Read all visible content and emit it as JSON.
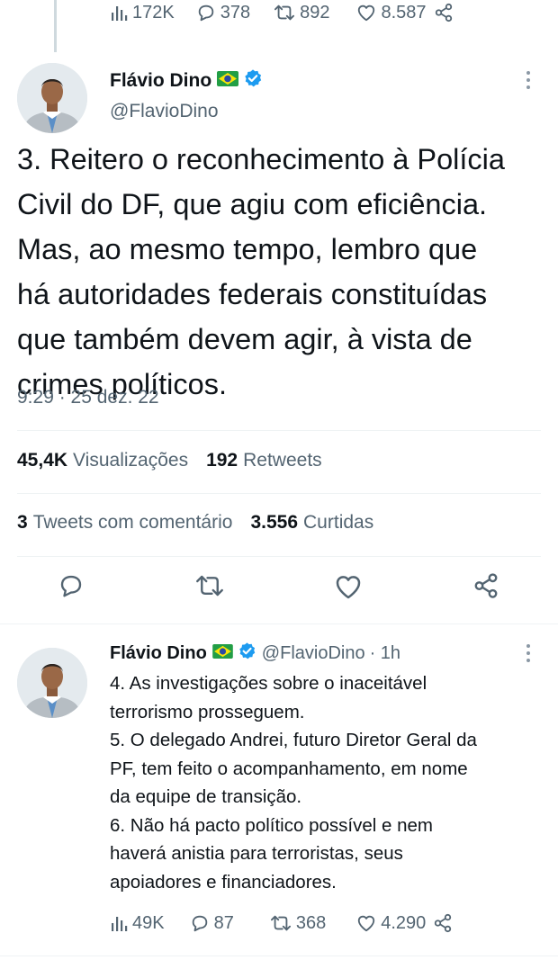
{
  "previous_tweet": {
    "metrics": {
      "views": "172K",
      "replies": "378",
      "retweets": "892",
      "likes": "8.587"
    }
  },
  "main_tweet": {
    "author": {
      "name": "Flávio Dino",
      "handle": "@FlavioDino"
    },
    "text_lines": [
      "3. Reitero o reconhecimento à Polícia",
      "Civil do DF, que agiu com eficiência.",
      "Mas, ao mesmo tempo, lembro que",
      "há autoridades federais constituídas",
      "que também devem agir, à vista de",
      "crimes políticos."
    ],
    "timestamp": "9:29 · 25 dez. 22",
    "stats": {
      "views_count": "45,4K",
      "views_label": "Visualizações",
      "retweets_count": "192",
      "retweets_label": "Retweets",
      "quotes_count": "3",
      "quotes_label": "Tweets com comentário",
      "likes_count": "3.556",
      "likes_label": "Curtidas"
    }
  },
  "reply_tweet": {
    "author": {
      "name": "Flávio Dino",
      "handle": "@FlavioDino",
      "time": "· 1h"
    },
    "paragraphs": [
      [
        "4. As investigações sobre o inaceitável",
        "terrorismo prosseguem."
      ],
      [
        "5. O delegado Andrei, futuro Diretor Geral da",
        "PF, tem feito o acompanhamento, em nome",
        "da equipe de transição."
      ],
      [
        "6. Não há pacto político possível e nem",
        "haverá anistia para terroristas, seus",
        "apoiadores e financiadores."
      ]
    ],
    "metrics": {
      "views": "49K",
      "replies": "87",
      "retweets": "368",
      "likes": "4.290"
    }
  },
  "icons": {
    "views": "bar-chart-icon",
    "reply": "speech-bubble-icon",
    "retweet": "retweet-arrows-icon",
    "like": "heart-icon",
    "share": "share-nodes-icon",
    "verified": "verified-badge-icon",
    "flag": "brazil-flag-icon",
    "more": "vertical-dots-icon"
  },
  "colors": {
    "text_primary": "#0f1419",
    "text_secondary": "#536471",
    "verified_blue": "#1d9bf0",
    "divider": "#eff3f4"
  }
}
